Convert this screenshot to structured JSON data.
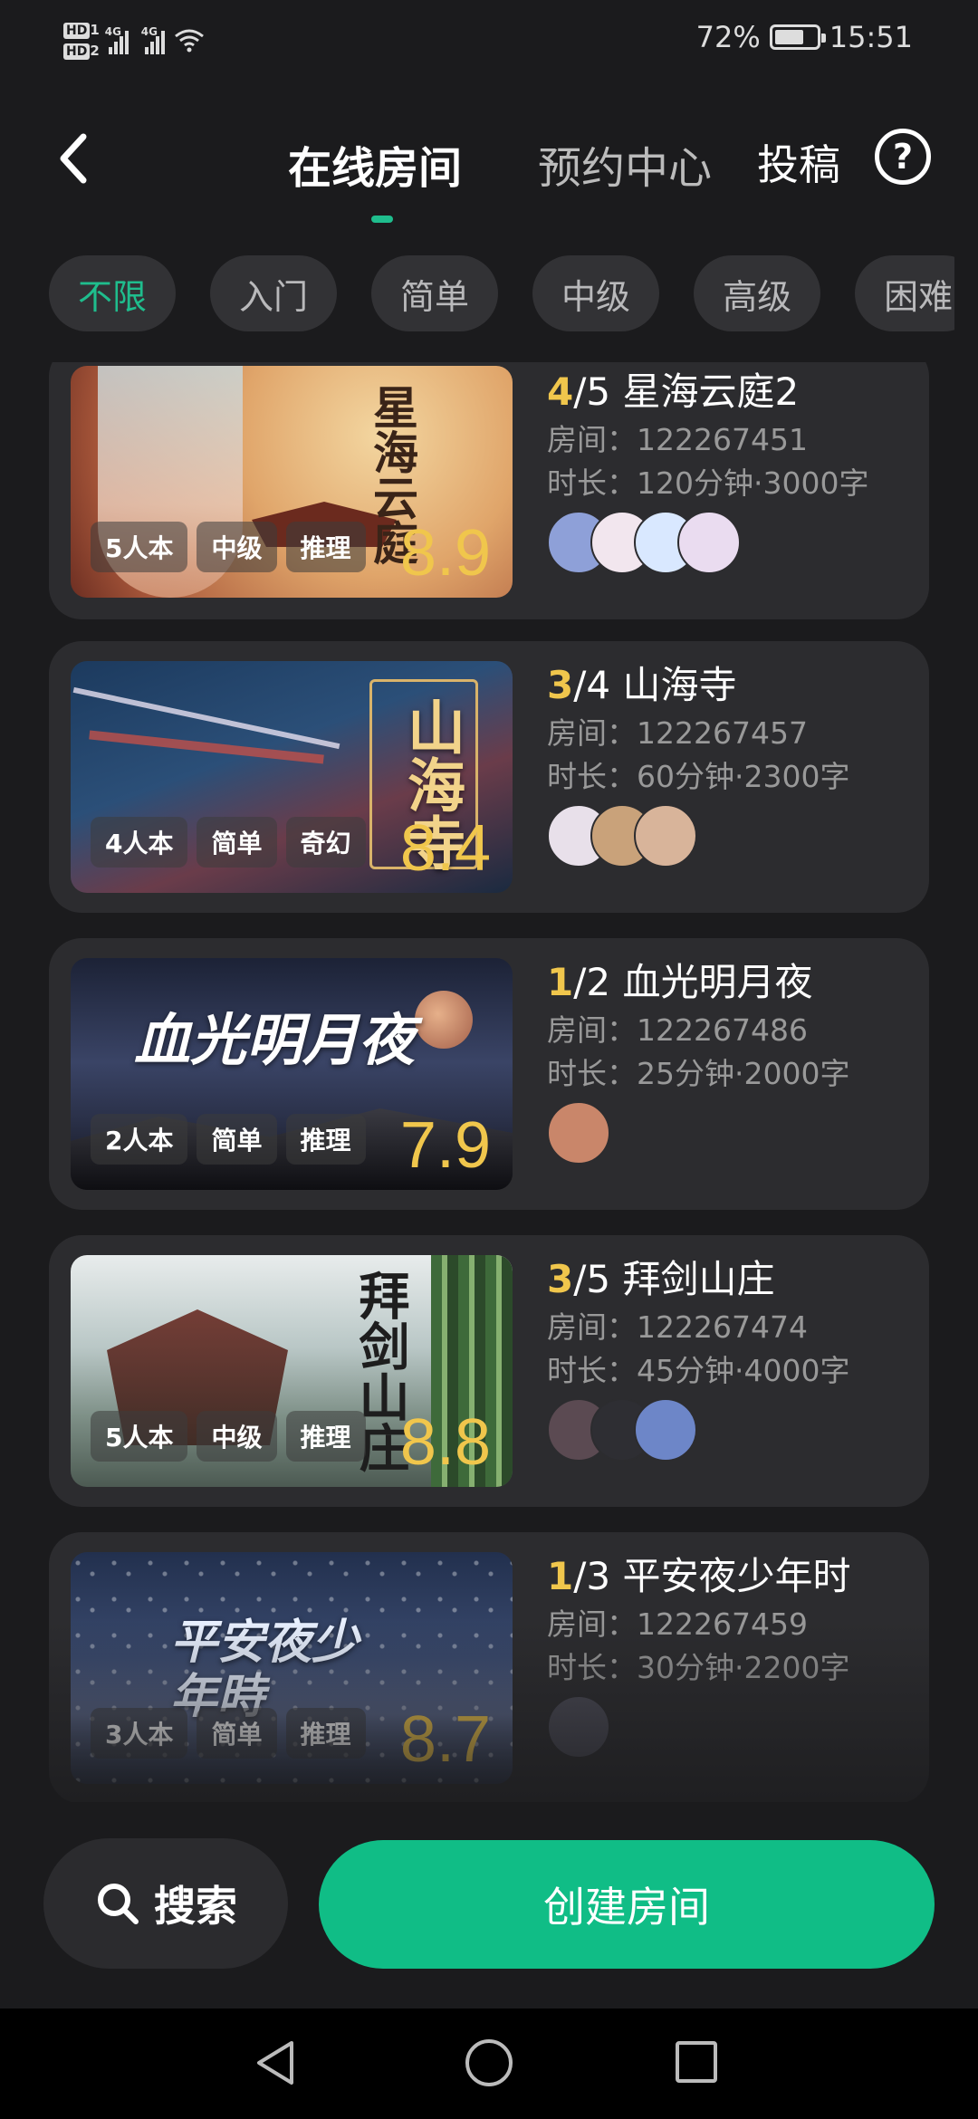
{
  "status_bar": {
    "hd1": "HD",
    "hd1_sub": "1",
    "hd2": "HD",
    "hd2_sub": "2",
    "net1": "4G",
    "net2": "4G",
    "battery_pct": "72%",
    "battery_level": 0.72,
    "time": "15:51"
  },
  "header": {
    "back_icon": "chevron-left-icon",
    "tab_active": "在线房间",
    "tab_inactive": "预约中心",
    "contribute": "投稿",
    "help": "?"
  },
  "filters": [
    "不限",
    "入门",
    "简单",
    "中级",
    "高级",
    "困难"
  ],
  "rooms": [
    {
      "current": "4",
      "total": "/5",
      "name": "星海云庭2",
      "room": "房间：122267451",
      "duration": "时长：120分钟·3000字",
      "thumb_title": "星海云庭",
      "tags": [
        "5人本",
        "中级",
        "推理"
      ],
      "score": "8.9",
      "avatar_colors": [
        "#8ea0d8",
        "#f2e6ee",
        "#d9e8ff",
        "#eadcf0"
      ]
    },
    {
      "current": "3",
      "total": "/4",
      "name": "山海寺",
      "room": "房间：122267457",
      "duration": "时长：60分钟·2300字",
      "thumb_title": "山海寺",
      "tags": [
        "4人本",
        "简单",
        "奇幻"
      ],
      "score": "8.4",
      "avatar_colors": [
        "#e8e0ea",
        "#c9a27a",
        "#d8b49a"
      ]
    },
    {
      "current": "1",
      "total": "/2",
      "name": "血光明月夜",
      "room": "房间：122267486",
      "duration": "时长：25分钟·2000字",
      "thumb_title": "血光明月夜",
      "tags": [
        "2人本",
        "简单",
        "推理"
      ],
      "score": "7.9",
      "avatar_colors": [
        "#c9866a"
      ]
    },
    {
      "current": "3",
      "total": "/5",
      "name": "拜剑山庄",
      "room": "房间：122267474",
      "duration": "时长：45分钟·4000字",
      "thumb_title": "拜剑山庄",
      "tags": [
        "5人本",
        "中级",
        "推理"
      ],
      "score": "8.8",
      "avatar_colors": [
        "#5b4a52",
        "#2e2e33",
        "#6d86c8"
      ]
    },
    {
      "current": "1",
      "total": "/3",
      "name": "平安夜少年时",
      "room": "房间：122267459",
      "duration": "时长：30分钟·2200字",
      "thumb_title": "平安夜少年時",
      "tags": [
        "3人本",
        "简单",
        "推理"
      ],
      "score": "8.7",
      "avatar_colors": [
        "#4a4a55"
      ]
    }
  ],
  "bottom": {
    "search_label": "搜索",
    "search_icon": "search-icon",
    "create_label": "创建房间"
  },
  "colors": {
    "accent": "#10bd86",
    "count_highlight": "#f0c64c",
    "background": "#1b1b1d",
    "card": "#2c2c2f"
  }
}
